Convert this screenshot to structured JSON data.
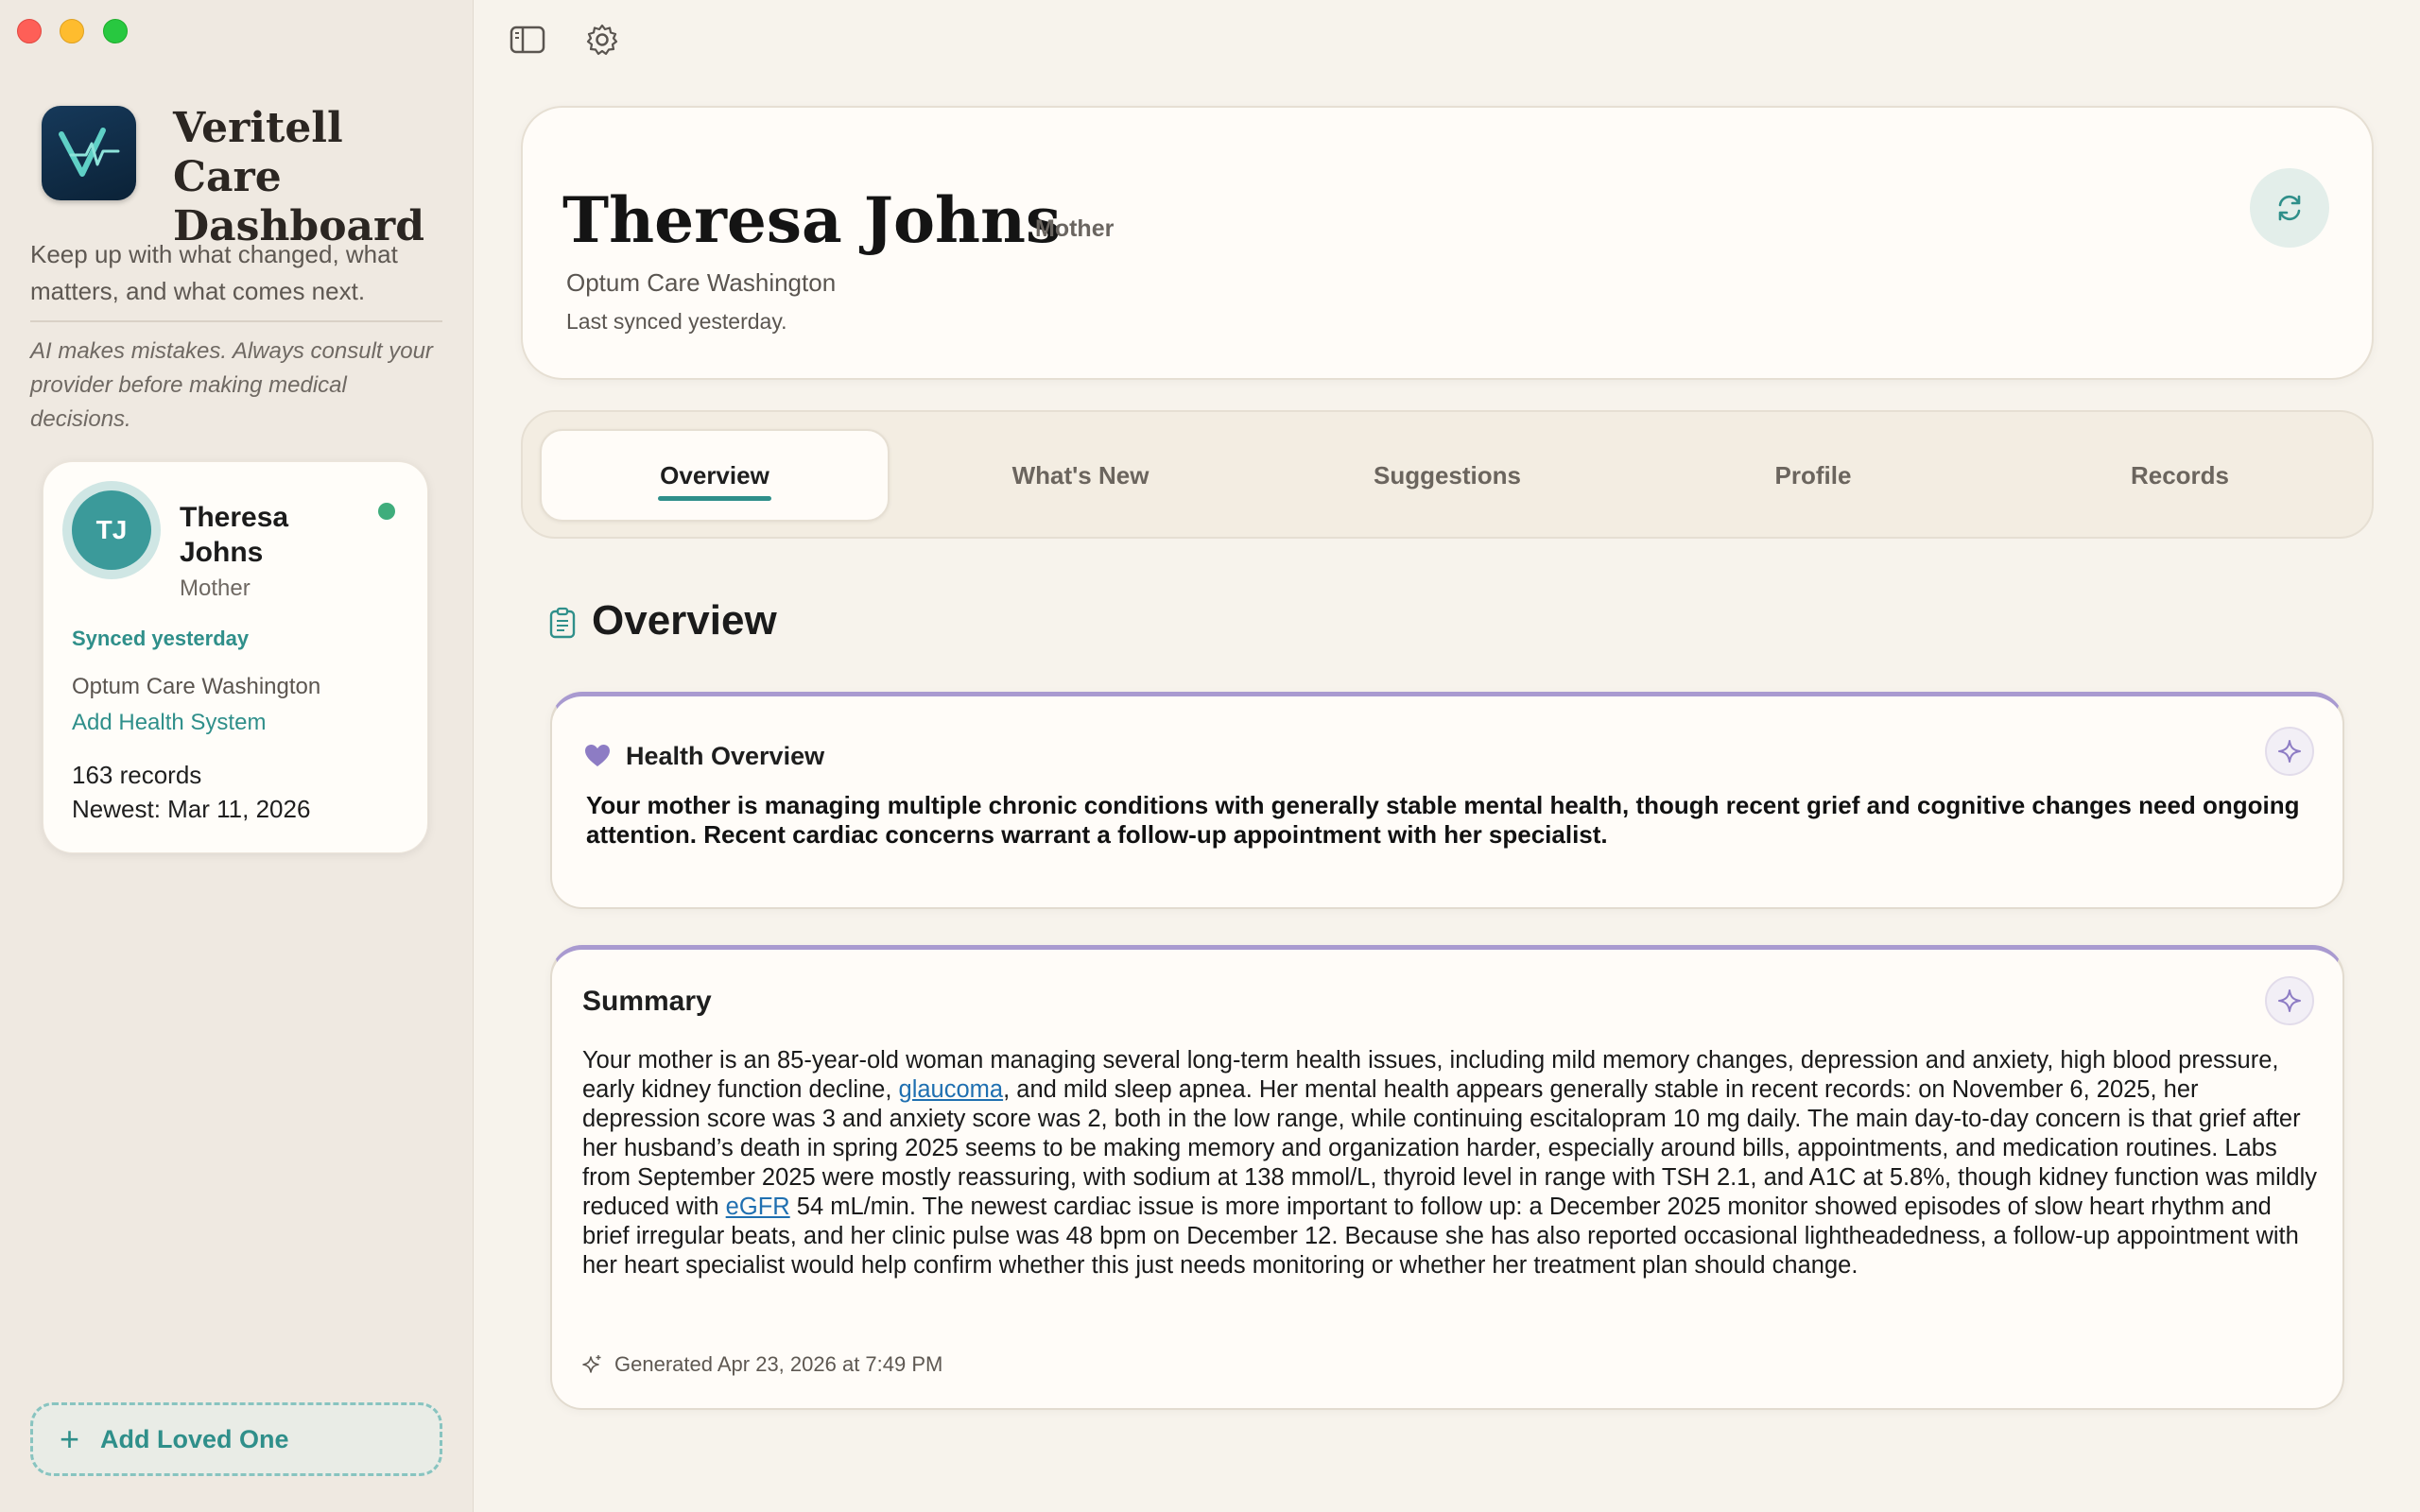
{
  "sidebar": {
    "app_title": "Veritell Care Dashboard",
    "tagline": "Keep up with what changed, what matters, and what comes next.",
    "disclaimer": "AI makes mistakes. Always consult your provider before making medical decisions.",
    "patient_card": {
      "initials": "TJ",
      "name": "Theresa Johns",
      "relation": "Mother",
      "sync_status": "Synced yesterday",
      "health_system": "Optum Care Washington",
      "add_system_label": "Add Health System",
      "records": "163 records",
      "newest": "Newest: Mar 11, 2026"
    },
    "add_loved_one_label": "Add Loved One"
  },
  "header": {
    "name": "Theresa Johns",
    "relation": "Mother",
    "health_system": "Optum Care Washington",
    "last_synced": "Last synced yesterday."
  },
  "tabs": [
    {
      "label": "Overview"
    },
    {
      "label": "What's New"
    },
    {
      "label": "Suggestions"
    },
    {
      "label": "Profile"
    },
    {
      "label": "Records"
    }
  ],
  "overview": {
    "title": "Overview",
    "health_overview": {
      "title": "Health Overview",
      "body": "Your mother is managing multiple chronic conditions with generally stable mental health, though recent grief and cognitive changes need ongoing attention. Recent cardiac concerns warrant a follow-up appointment with her specialist."
    },
    "summary": {
      "title": "Summary",
      "part1": "Your mother is an 85-year-old woman managing several long-term health issues, including mild memory changes, depression and anxiety, high blood pressure, early kidney function decline, ",
      "link1": "glaucoma",
      "part2": ", and mild sleep apnea. Her mental health appears generally stable in recent records: on November 6, 2025, her depression score was 3 and anxiety score was 2, both in the low range, while continuing escitalopram 10 mg daily. The main day-to-day concern is that grief after her husband’s death in spring 2025 seems to be making memory and organization harder, especially around bills, appointments, and medication routines. Labs from September 2025 were mostly reassuring, with sodium at 138 mmol/L, thyroid level in range with TSH 2.1, and A1C at 5.8%, though kidney function was mildly reduced with ",
      "link2": "eGFR",
      "part3": " 54 mL/min. The newest cardiac issue is more important to follow up: a December 2025 monitor showed episodes of slow heart rhythm and brief irregular beats, and her clinic pulse was 48 bpm on December 12. Because she has also reported occasional lightheadedness, a follow-up appointment with her heart specialist would help confirm whether this just needs monitoring or whether her treatment plan should change.",
      "generated": "Generated Apr 23, 2026 at 7:49 PM"
    }
  },
  "colors": {
    "accent_teal": "#2f8f8a",
    "accent_purple": "#a99ad0",
    "status_green": "#3fad7c"
  }
}
